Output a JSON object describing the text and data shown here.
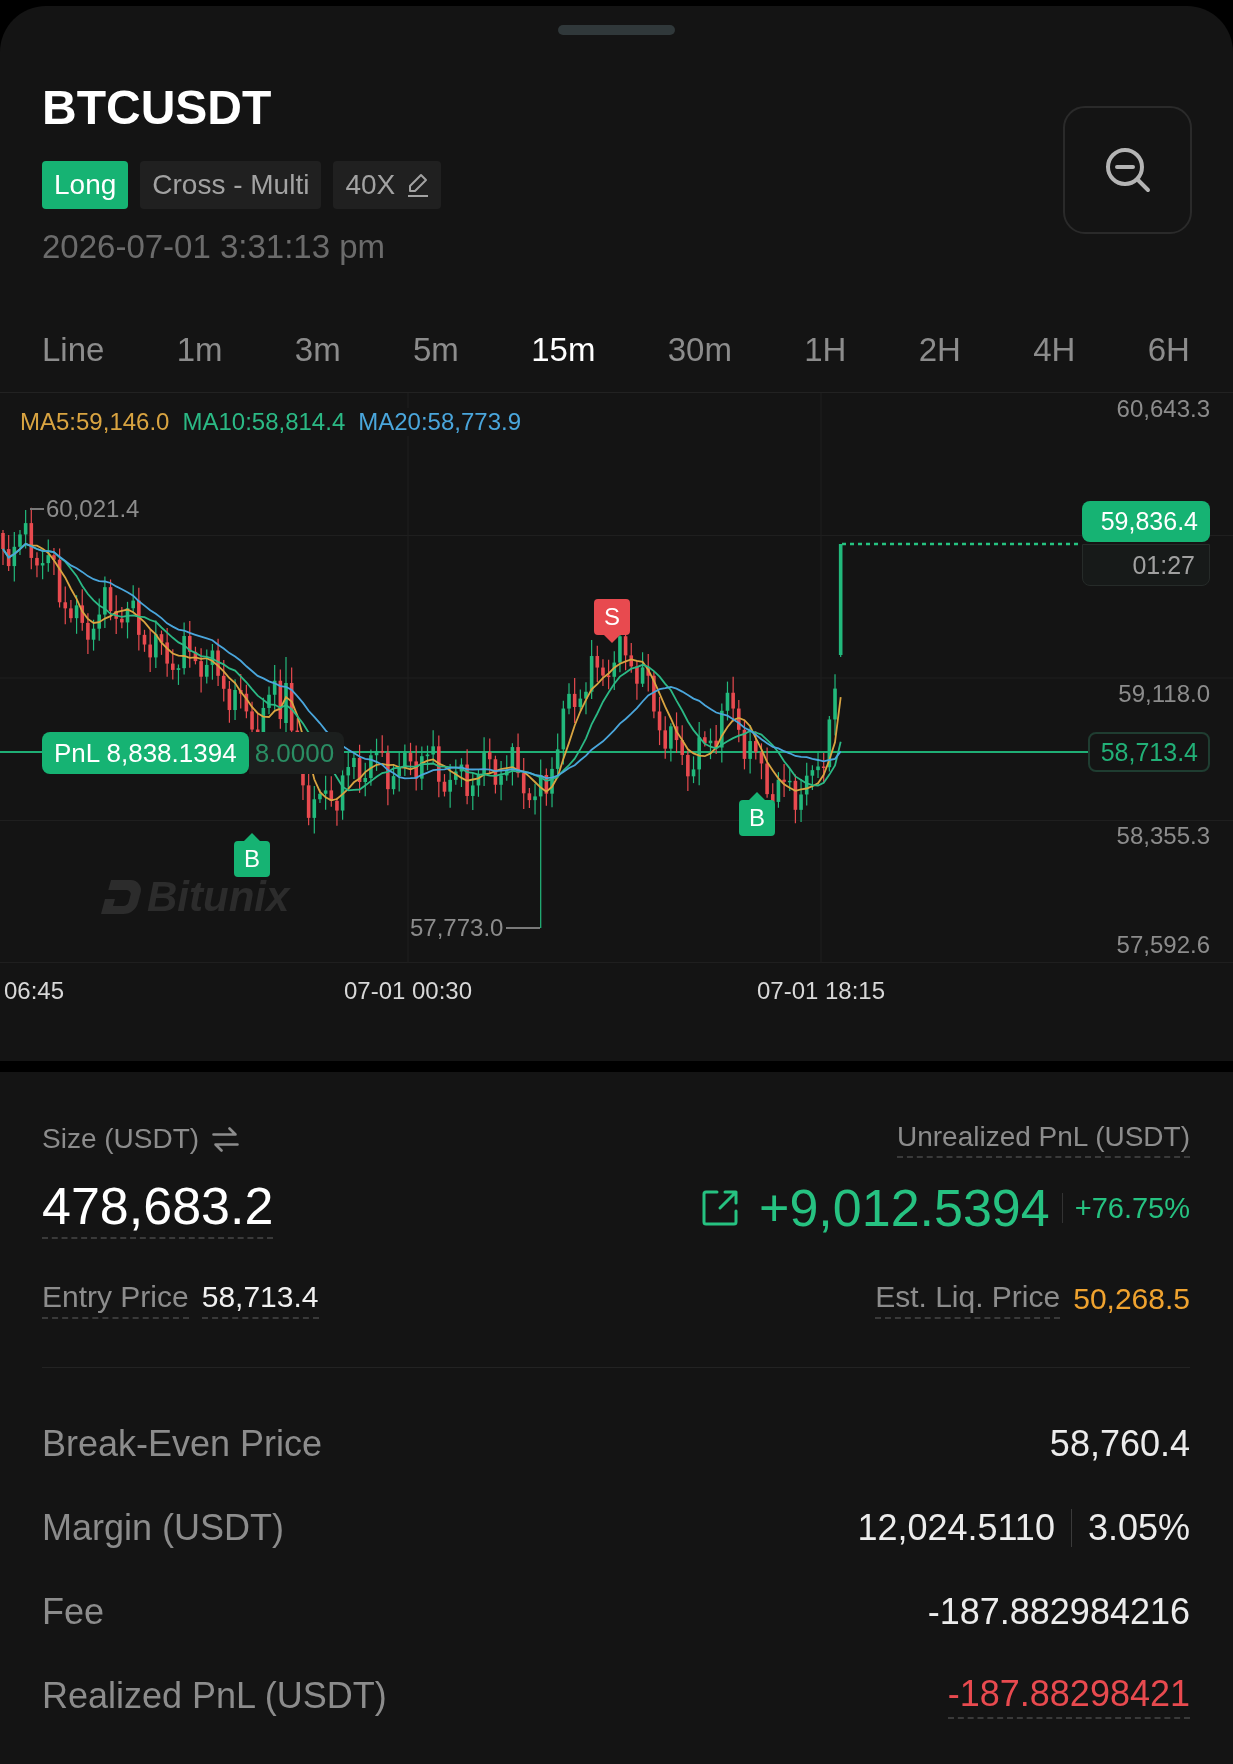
{
  "header": {
    "symbol": "BTCUSDT",
    "tags": [
      {
        "kind": "side",
        "label": "Long",
        "editable": false
      },
      {
        "kind": "mode",
        "label": "Cross - Multi",
        "editable": false
      },
      {
        "kind": "leverage",
        "label": "40X",
        "editable": true
      }
    ],
    "timestamp": "2026-07-01 3:31:13 pm"
  },
  "timeframes": [
    {
      "label": "Line",
      "selected": false
    },
    {
      "label": "1m",
      "selected": false
    },
    {
      "label": "3m",
      "selected": false
    },
    {
      "label": "5m",
      "selected": false
    },
    {
      "label": "15m",
      "selected": true
    },
    {
      "label": "30m",
      "selected": false
    },
    {
      "label": "1H",
      "selected": false
    },
    {
      "label": "2H",
      "selected": false
    },
    {
      "label": "4H",
      "selected": false
    },
    {
      "label": "6H",
      "selected": false
    }
  ],
  "chart": {
    "ma_legend": [
      {
        "label": "MA5:59,146.0",
        "color": "#d9a441"
      },
      {
        "label": "MA10:58,814.4",
        "color": "#2bb985"
      },
      {
        "label": "MA20:58,773.9",
        "color": "#4aa6dc"
      }
    ],
    "y_labels": [
      "60,643.3",
      "59,118.0",
      "58,355.3",
      "57,592.6"
    ],
    "high_label": "60,021.4",
    "low_label": "57,773.0",
    "markers": [
      {
        "kind": "buy",
        "label": "B"
      },
      {
        "kind": "sell",
        "label": "S"
      },
      {
        "kind": "buy",
        "label": "B"
      }
    ],
    "pnl_tag": {
      "label": "PnL 8,838.1394",
      "quantity": "8.0000"
    },
    "last_price": "59,836.4",
    "countdown": "01:27",
    "entry_price": "58,713.4",
    "watermark": "Bitunix",
    "x_labels": [
      "06:45",
      "07-01 00:30",
      "07-01 18:15"
    ]
  },
  "position": {
    "size_label": "Size (USDT)",
    "size": "478,683.2",
    "upnl_label": "Unrealized PnL (USDT)",
    "upnl": "+9,012.5394",
    "upnl_pct": "+76.75%",
    "entry_label": "Entry Price",
    "entry": "58,713.4",
    "liq_label": "Est. Liq. Price",
    "liq": "50,268.5"
  },
  "details": [
    {
      "label": "Break-Even Price",
      "value": "58,760.4",
      "negative": false,
      "has_tooltip": false
    },
    {
      "label": "Margin (USDT)",
      "value": "12,024.5110",
      "extra": "3.05%",
      "negative": false,
      "has_tooltip": false
    },
    {
      "label": "Fee",
      "value": "-187.882984216",
      "negative": false,
      "has_tooltip": false
    },
    {
      "label": "Realized PnL (USDT)",
      "value": "-187.88298421",
      "negative": true,
      "has_tooltip": true
    }
  ]
}
